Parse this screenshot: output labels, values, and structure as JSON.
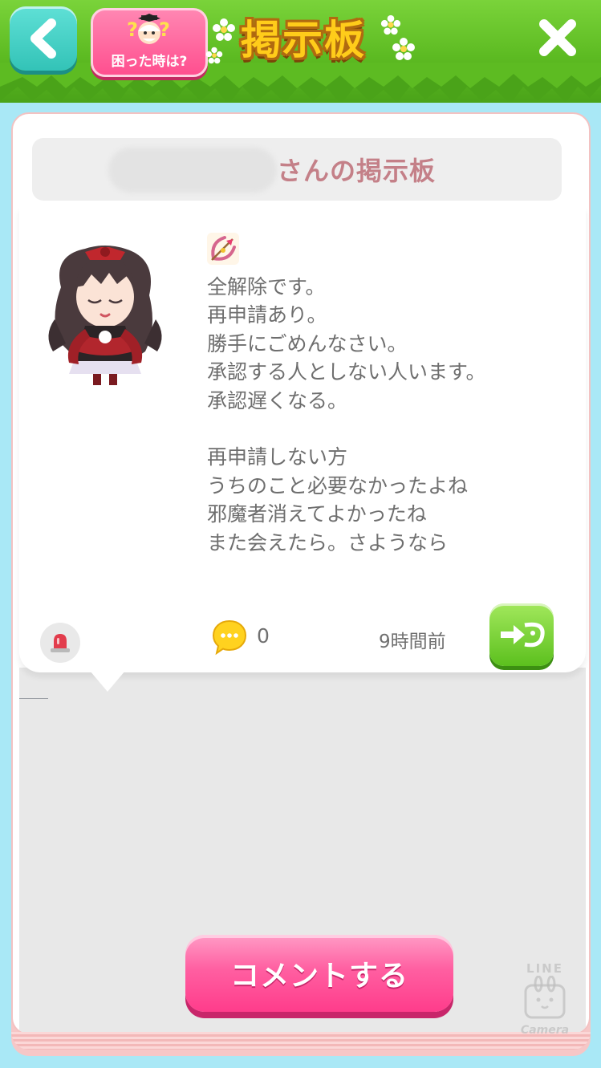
{
  "header": {
    "help_label": "困った時は?",
    "title": "掲示板"
  },
  "board": {
    "owner_name": "",
    "title_suffix": "さんの掲示板"
  },
  "post": {
    "body": "全解除です。\n再申請あり。\n勝手にごめんなさい。\n承認する人としない人います。\n承認遅くなる。\n\n再申請しない方\nうちのこと必要なかったよね\n邪魔者消えてよかったね\nまた会えたら。さようなら",
    "comment_count": "0",
    "time_ago": "9時間前"
  },
  "footer": {
    "comment_button": "コメントする"
  },
  "watermark": {
    "top": "LINE",
    "bottom": "Camera"
  },
  "colors": {
    "header_green": "#5dbb22",
    "background_blue": "#a9e8f6",
    "accent_pink": "#ff4f8f",
    "title_yellow": "#ffcc1a"
  },
  "icons": {
    "back": "chevron-left-icon",
    "close": "close-icon",
    "stamp": "bow-arrow-icon",
    "report": "siren-icon",
    "comment": "speech-bubble-icon",
    "visit": "visit-arrow-icon"
  }
}
